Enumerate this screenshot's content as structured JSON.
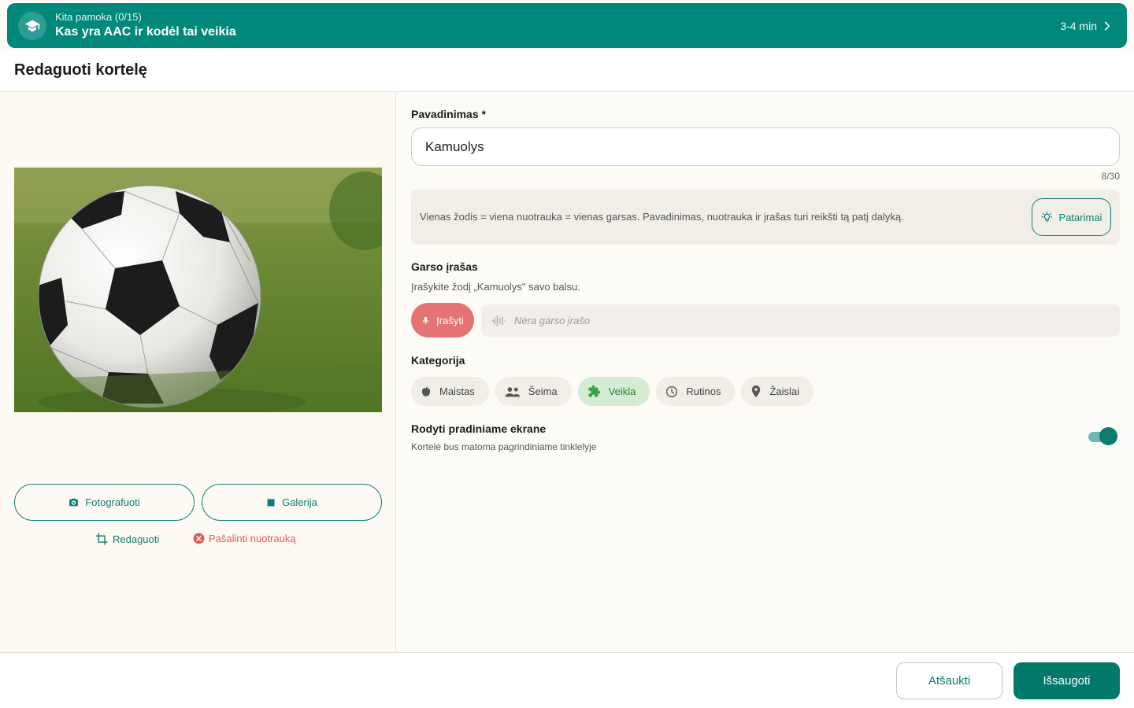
{
  "banner": {
    "subtitle": "Kita pamoka (0/15)",
    "title": "Kas yra AAC ir kodėl tai veikia",
    "duration": "3-4 min"
  },
  "page": {
    "title": "Redaguoti kortelę"
  },
  "photo_panel": {
    "camera_label": "Fotografuoti",
    "gallery_label": "Galerija",
    "edit_label": "Redaguoti",
    "remove_label": "Pašalinti nuotrauką"
  },
  "form": {
    "name_label": "Pavadinimas *",
    "name_value": "Kamuolys",
    "name_counter": "8/30",
    "hint_text": "Vienas žodis = viena nuotrauka = vienas garsas. Pavadinimas, nuotrauka ir įrašas turi reikšti tą patį dalyką.",
    "tips_label": "Patarimai",
    "audio_label": "Garso įrašas",
    "audio_hint": "Įrašykite žodį „Kamuolys\" savo balsu.",
    "record_label": "Įrašyti",
    "audio_empty": "Nėra garso įrašo",
    "category_label": "Kategorija",
    "categories": [
      {
        "label": "Maistas",
        "icon": "apple-icon"
      },
      {
        "label": "Šeima",
        "icon": "people-icon"
      },
      {
        "label": "Veikla",
        "icon": "puzzle-icon",
        "active": true
      },
      {
        "label": "Rutinos",
        "icon": "clock-icon"
      },
      {
        "label": "Žaislai",
        "icon": "location-pin-icon"
      }
    ],
    "home_label": "Rodyti pradiniame ekrane",
    "home_hint": "Kortelė bus matoma pagrindiniame tinklelyje",
    "home_enabled": true
  },
  "footer": {
    "cancel_label": "Atšaukti",
    "save_label": "Išsaugoti"
  },
  "colors": {
    "primary": "#00897b",
    "accent_red": "#e57373",
    "active_chip": "#d4ecd3"
  }
}
